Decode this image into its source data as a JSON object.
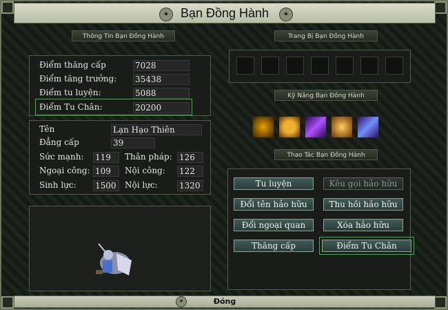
{
  "window": {
    "title": "Bạn Đồng Hành",
    "close_label": "Đóng"
  },
  "headers": {
    "info": "Thông Tin Bạn Đồng Hành",
    "equipment": "Trang Bị Bạn Đồng Hành",
    "skills": "Kỹ Năng Bạn Đồng Hành",
    "actions": "Thao Tác Bạn Đồng Hành"
  },
  "points": [
    {
      "label": "Điểm thăng cấp",
      "value": "7028"
    },
    {
      "label": "Điểm tăng trưởng:",
      "value": "35438"
    },
    {
      "label": "Điểm tu luyện:",
      "value": "5088"
    },
    {
      "label": "Điểm Tu Chân:",
      "value": "20200"
    }
  ],
  "info": {
    "name_label": "Tên",
    "name_value": "Lạn Hạo Thiên",
    "level_label": "Đẳng cấp",
    "level_value": "39"
  },
  "stats": [
    {
      "label": "Sức mạnh:",
      "value": "119"
    },
    {
      "label": "Thân pháp:",
      "value": "126"
    },
    {
      "label": "Ngoại công:",
      "value": "109"
    },
    {
      "label": "Nội công:",
      "value": "122"
    },
    {
      "label": "Sinh lực:",
      "value": "1500"
    },
    {
      "label": "Nội lực:",
      "value": "1320"
    }
  ],
  "skills": [
    {
      "name": "claw-skill-icon",
      "colors": [
        "#e8a000",
        "#3a2000"
      ]
    },
    {
      "name": "spiral-skill-icon",
      "colors": [
        "#f0b030",
        "#5a2a00"
      ]
    },
    {
      "name": "purple-slash-skill-icon",
      "colors": [
        "#b050ff",
        "#2a0a50"
      ]
    },
    {
      "name": "golden-fan-skill-icon",
      "colors": [
        "#ffd060",
        "#6a3000"
      ]
    },
    {
      "name": "blue-slash-skill-icon",
      "colors": [
        "#7090ff",
        "#301060"
      ]
    }
  ],
  "actions": {
    "tu_luyen": "Tu luyện",
    "keu_goi": "Kêu gọi hảo hữu",
    "doi_ten": "Đổi tên hảo hữu",
    "thu_hoi": "Thu hồi hảo hữu",
    "doi_ngoai_quan": "Đổi ngoại quan",
    "xoa": "Xóa hảo hữu",
    "thang_cap": "Thăng cấp",
    "diem_tu_chan": "Điểm Tu Chân"
  },
  "colors": {
    "highlight": "#2fbf3a",
    "button": "#3f5a55"
  }
}
